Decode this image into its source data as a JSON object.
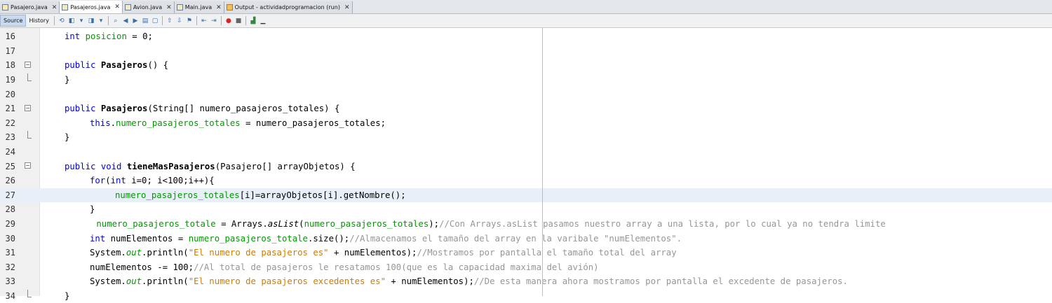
{
  "tabs": [
    {
      "label": "Pasajero.java",
      "active": false
    },
    {
      "label": "Pasajeros.java",
      "active": true
    },
    {
      "label": "Avion.java",
      "active": false
    },
    {
      "label": "Main.java",
      "active": false
    },
    {
      "label": "Output - actividadprogramacion (run)",
      "active": false
    }
  ],
  "toolbar": {
    "source_label": "Source",
    "history_label": "History"
  },
  "lines": [
    {
      "num": "16"
    },
    {
      "num": "17"
    },
    {
      "num": "18"
    },
    {
      "num": "19"
    },
    {
      "num": "20"
    },
    {
      "num": "21"
    },
    {
      "num": "22"
    },
    {
      "num": "23"
    },
    {
      "num": "24"
    },
    {
      "num": "25"
    },
    {
      "num": "26"
    },
    {
      "num": "27"
    },
    {
      "num": "28"
    },
    {
      "num": "29"
    },
    {
      "num": "30"
    },
    {
      "num": "31"
    },
    {
      "num": "32"
    },
    {
      "num": "33"
    },
    {
      "num": "34"
    }
  ],
  "code": {
    "l16": {
      "kw": "int",
      "fld": "posicion",
      "rest": " = 0;"
    },
    "l18": {
      "kw": "public",
      "name": "Pasajeros",
      "rest": "() {"
    },
    "l19": {
      "rest": "}"
    },
    "l21": {
      "kw": "public",
      "name": "Pasajeros",
      "rest": "(String[] numero_pasajeros_totales) {"
    },
    "l22": {
      "kw": "this",
      "fld": "numero_pasajeros_totales",
      "rest": " = numero_pasajeros_totales;"
    },
    "l23": {
      "rest": "}"
    },
    "l25": {
      "kw": "public void",
      "name": "tieneMasPasajeros",
      "rest": "(Pasajero[] arrayObjetos) {"
    },
    "l26": {
      "kw1": "for",
      "p1": "(",
      "kw2": "int",
      "rest": " i=0; i<100;i++){"
    },
    "l27": {
      "fld": "numero_pasajeros_totales",
      "rest": "[i]=arrayObjetos[i].getNombre();"
    },
    "l28": {
      "rest": "}"
    },
    "l29": {
      "fld1": "numero_pasajeros_totale",
      "p1": " = Arrays.",
      "it": "asList",
      "p2": "(",
      "fld2": "numero_pasajeros_totales",
      "p3": ");",
      "cmt": "//Con Arrays.asList pasamos nuestro array a una lista, por lo cual ya no tendra limite"
    },
    "l30": {
      "kw": "int",
      "p1": " numElementos = ",
      "fld": "numero_pasajeros_totale",
      "p2": ".size();",
      "cmt": "//Almacenamos el tamaño del array en la varibale \"numElementos\"."
    },
    "l31": {
      "p1": "System.",
      "it": "out",
      "p2": ".println(",
      "str": "\"El numero de pasajeros es\"",
      "p3": " + numElementos);",
      "cmt": "//Mostramos por pantalla el tamaño total del array"
    },
    "l32": {
      "p1": "numElementos -= 100;",
      "cmt": "//Al total de pasajeros le resatamos 100(que es la capacidad maxima del avión)"
    },
    "l33": {
      "p1": "System.",
      "it": "out",
      "p2": ".println(",
      "str": "\"El numero de pasajeros excedentes es\"",
      "p3": " + numElementos);",
      "cmt": "//De esta manera ahora mostramos por pantalla el excedente de pasajeros."
    },
    "l34": {
      "rest": "}"
    }
  }
}
